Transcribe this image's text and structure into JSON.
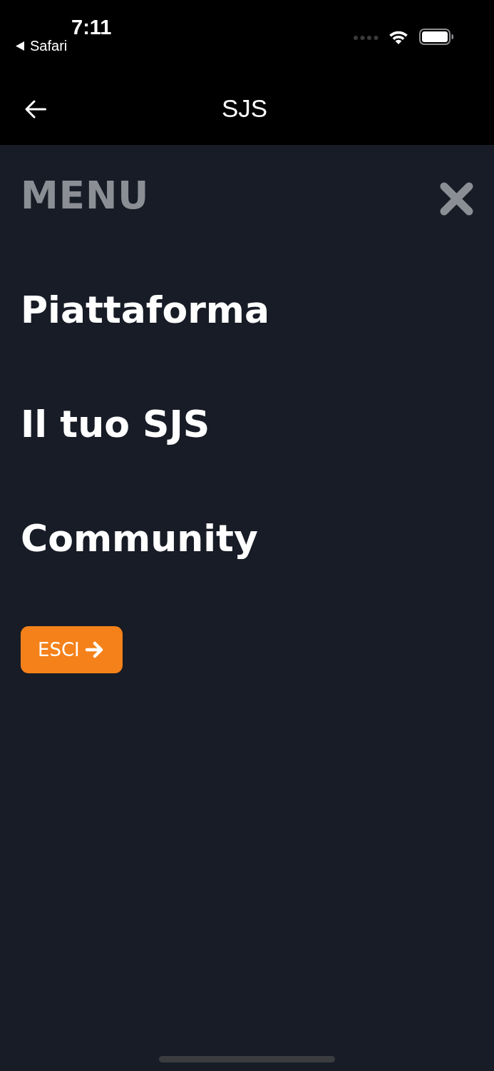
{
  "status_bar": {
    "time": "7:11",
    "back_app": "Safari"
  },
  "nav_bar": {
    "title": "SJS"
  },
  "menu": {
    "heading": "MENU",
    "items": [
      {
        "label": "Piattaforma"
      },
      {
        "label": "Il tuo SJS"
      },
      {
        "label": "Community"
      }
    ],
    "logout": {
      "label": "ESCI"
    }
  }
}
